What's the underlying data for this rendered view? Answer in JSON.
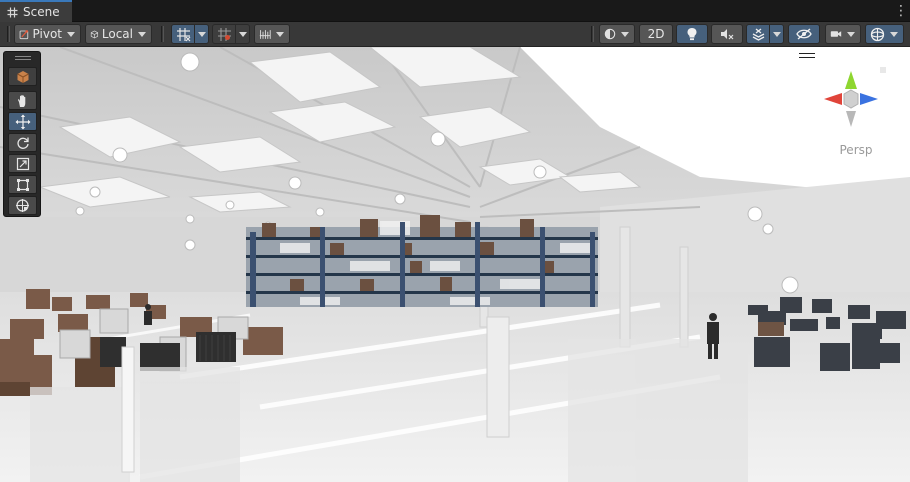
{
  "tab": {
    "title": "Scene",
    "icon": "grid-hash-icon"
  },
  "toolbar": {
    "pivot_label": "Pivot",
    "local_label": "Local",
    "mode_2d_label": "2D"
  },
  "gizmo": {
    "projection_label": "Persp"
  },
  "colors": {
    "accent": "#46607c",
    "tab_highlight": "#3a79bb",
    "toolbar_bg": "#383838",
    "gizmo_x": "#e0443a",
    "gizmo_y": "#8ed630",
    "gizmo_z": "#3a72e0"
  }
}
